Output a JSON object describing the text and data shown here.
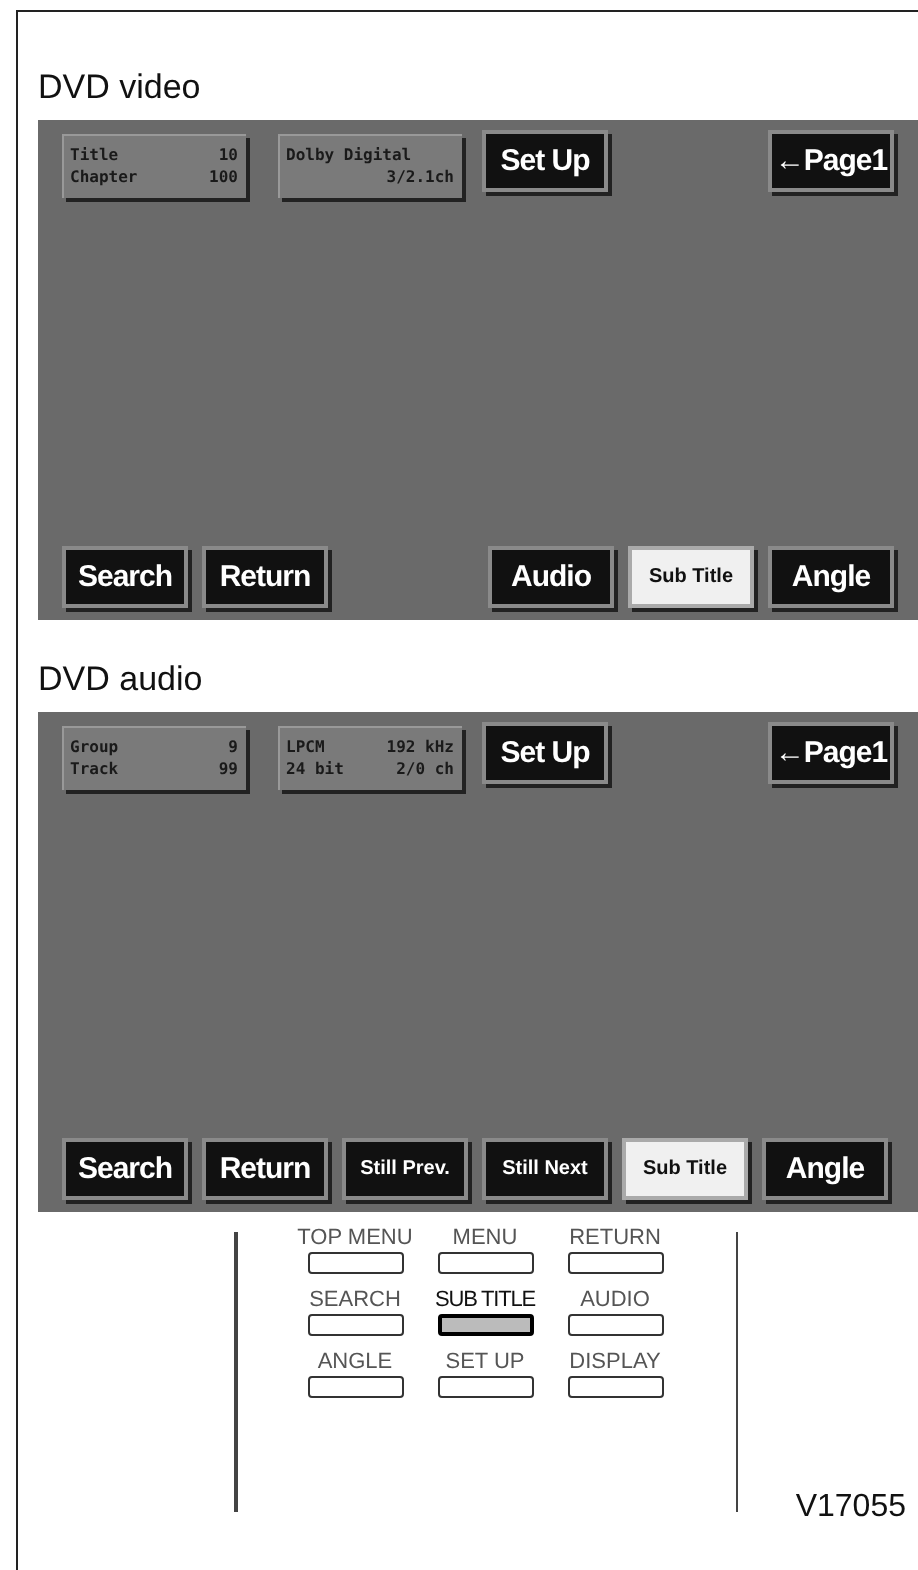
{
  "sections": [
    {
      "title": "DVD video",
      "screen": {
        "info_panels": [
          {
            "rows": [
              [
                "Title",
                "10"
              ],
              [
                "Chapter",
                "100"
              ]
            ]
          },
          {
            "rows": [
              [
                "Dolby Digital",
                ""
              ],
              [
                "",
                "3/2.1ch"
              ]
            ]
          }
        ],
        "setup_button": "Set Up",
        "page_button": "←Page1",
        "bottom_groups": [
          [
            {
              "label": "Search",
              "kind": "single",
              "selected": false
            },
            {
              "label": "Return",
              "kind": "single",
              "selected": false
            }
          ],
          [
            {
              "label": "Audio",
              "kind": "single",
              "selected": false
            },
            {
              "label": "Sub Title",
              "kind": "double",
              "selected": true
            },
            {
              "label": "Angle",
              "kind": "single",
              "selected": false
            }
          ]
        ]
      }
    },
    {
      "title": "DVD audio",
      "screen": {
        "info_panels": [
          {
            "rows": [
              [
                "Group",
                "9"
              ],
              [
                "Track",
                "99"
              ]
            ]
          },
          {
            "rows": [
              [
                "LPCM",
                "192 kHz"
              ],
              [
                "24 bit",
                "2/0 ch"
              ]
            ]
          }
        ],
        "setup_button": "Set Up",
        "page_button": "←Page1",
        "bottom_groups": [
          [
            {
              "label": "Search",
              "kind": "single",
              "selected": false
            },
            {
              "label": "Return",
              "kind": "single",
              "selected": false
            },
            {
              "label": "Still Prev.",
              "kind": "double",
              "selected": false
            },
            {
              "label": "Still Next",
              "kind": "double",
              "selected": false
            },
            {
              "label": "Sub Title",
              "kind": "double",
              "selected": true
            },
            {
              "label": "Angle",
              "kind": "single",
              "selected": false
            }
          ]
        ]
      }
    }
  ],
  "remote": {
    "rows": [
      [
        {
          "label": "TOP MENU",
          "selected": false
        },
        {
          "label": "MENU",
          "selected": false
        },
        {
          "label": "RETURN",
          "selected": false
        }
      ],
      [
        {
          "label": "SEARCH",
          "selected": false
        },
        {
          "label": "SUB TITLE",
          "selected": true
        },
        {
          "label": "AUDIO",
          "selected": false
        }
      ],
      [
        {
          "label": "ANGLE",
          "selected": false
        },
        {
          "label": "SET UP",
          "selected": false
        },
        {
          "label": "DISPLAY",
          "selected": false
        }
      ]
    ]
  },
  "figure_code": "V17055"
}
